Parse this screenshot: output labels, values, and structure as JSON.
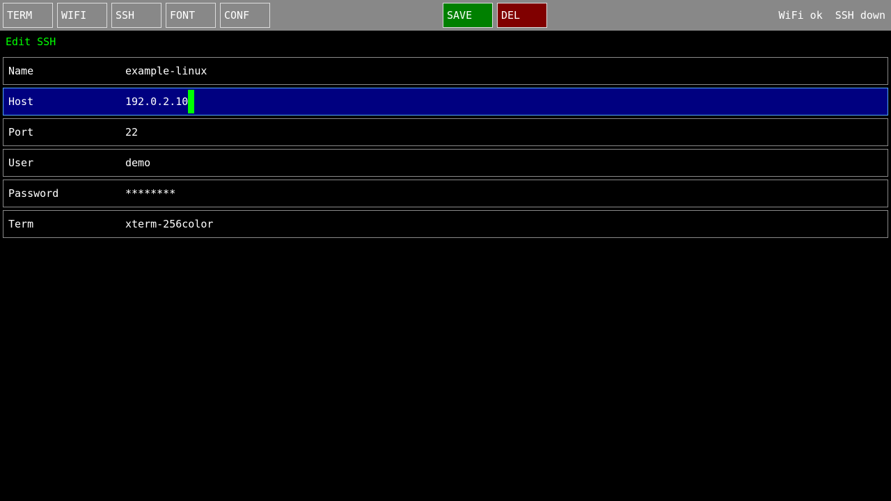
{
  "toolbar": {
    "tabs": [
      {
        "label": "TERM"
      },
      {
        "label": "WIFI"
      },
      {
        "label": "SSH"
      },
      {
        "label": "FONT"
      },
      {
        "label": "CONF"
      }
    ],
    "save_label": "SAVE",
    "del_label": "DEL"
  },
  "status": {
    "wifi": "WiFi ok",
    "ssh": "SSH down"
  },
  "page": {
    "title": "Edit SSH"
  },
  "fields": [
    {
      "label": "Name",
      "value": "example-linux"
    },
    {
      "label": "Host",
      "value": "192.0.2.10",
      "selected": true
    },
    {
      "label": "Port",
      "value": "22"
    },
    {
      "label": "User",
      "value": "demo"
    },
    {
      "label": "Password",
      "value": "********"
    },
    {
      "label": "Term",
      "value": "xterm-256color"
    }
  ],
  "colors": {
    "toolbar_bg": "#888888",
    "save_bg": "#008000",
    "del_bg": "#800000",
    "title_fg": "#00ff00",
    "selected_row_bg": "#000080",
    "cursor": "#00ff00"
  }
}
